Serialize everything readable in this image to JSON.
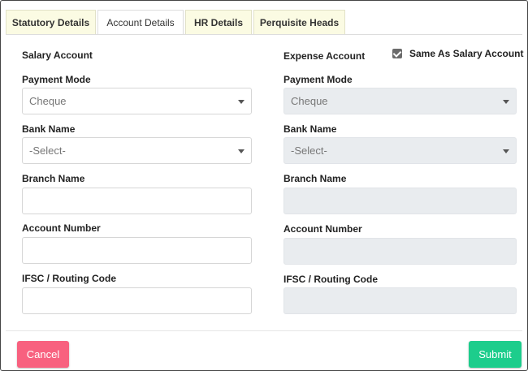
{
  "tabs": [
    {
      "label": "Statutory Details",
      "active": false
    },
    {
      "label": "Account Details",
      "active": true
    },
    {
      "label": "HR Details",
      "active": false
    },
    {
      "label": "Perquisite Heads",
      "active": false
    }
  ],
  "salary": {
    "title": "Salary Account",
    "payment_mode_label": "Payment Mode",
    "payment_mode_value": "Cheque",
    "bank_name_label": "Bank Name",
    "bank_name_value": "-Select-",
    "branch_name_label": "Branch Name",
    "branch_name_value": "",
    "account_number_label": "Account Number",
    "account_number_value": "",
    "ifsc_label": "IFSC / Routing Code",
    "ifsc_value": ""
  },
  "expense": {
    "title": "Expense Account",
    "same_as_label": "Same As Salary Account",
    "same_as_checked": true,
    "payment_mode_label": "Payment Mode",
    "payment_mode_value": "Cheque",
    "bank_name_label": "Bank Name",
    "bank_name_value": "-Select-",
    "branch_name_label": "Branch Name",
    "branch_name_value": "",
    "account_number_label": "Account Number",
    "account_number_value": "",
    "ifsc_label": "IFSC / Routing Code",
    "ifsc_value": ""
  },
  "footer": {
    "cancel_label": "Cancel",
    "submit_label": "Submit"
  },
  "colors": {
    "cancel": "#f8617f",
    "submit": "#1dcd8c",
    "tab_inactive": "#fbfbe3"
  }
}
